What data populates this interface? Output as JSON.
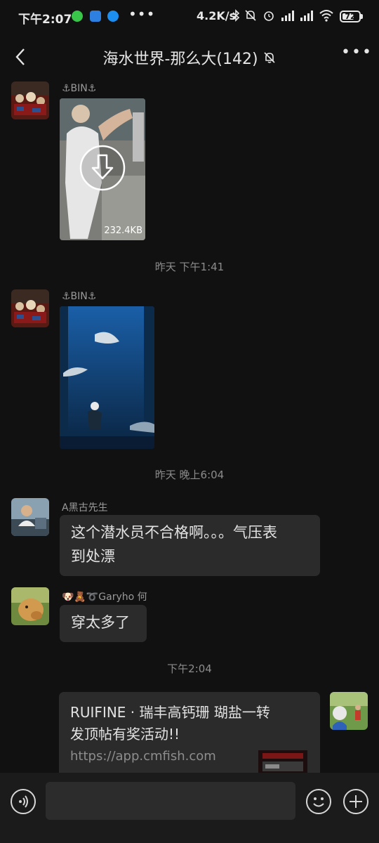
{
  "status_bar": {
    "time": "下午2:07",
    "more_dots": "•••",
    "network_speed": "4.2K/s",
    "battery": "72",
    "battery_level": 0.72
  },
  "header": {
    "title": "海水世界-那么大(142)",
    "more_label": "•••"
  },
  "messages": [
    {
      "sender": "⚓BIN⚓",
      "type": "video",
      "size": "232.4KB"
    },
    {
      "time_separator": "昨天 下午1:41"
    },
    {
      "sender": "⚓BIN⚓",
      "type": "image"
    },
    {
      "time_separator": "昨天 晚上6:04"
    },
    {
      "sender": "A黑古先生",
      "type": "text",
      "text_line1": "这个潜水员不合格啊。。。气压表",
      "text_line2": "到处漂"
    },
    {
      "sender": "🐶🧸➰Garyho 何",
      "type": "text",
      "text": "穿太多了"
    },
    {
      "time_separator": "下午2:04"
    },
    {
      "type": "link",
      "title_line1": "RUIFINE · 瑞丰高钙珊 瑚盐一转",
      "title_line2": "发顶帖有奖活动!!",
      "url": "https://app.cmfish.com"
    }
  ],
  "colors": {
    "background": "#111111",
    "bubble": "#2b2b2b",
    "bottom_bar": "#1b1b1b"
  },
  "icons": [
    "back-arrow-icon",
    "mute-bell-icon",
    "more-icon",
    "download-icon",
    "voice-icon",
    "emoji-icon",
    "plus-icon"
  ]
}
